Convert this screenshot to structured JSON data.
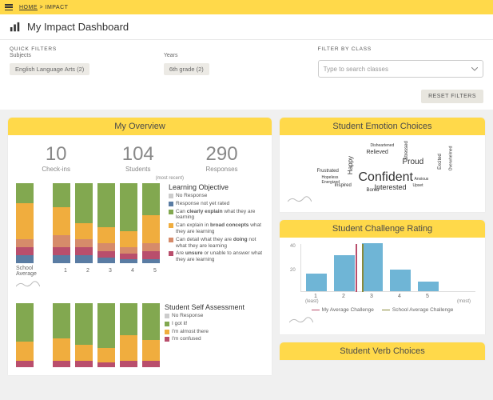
{
  "breadcrumb": {
    "home": "HOME",
    "sep": ">",
    "current": "IMPACT"
  },
  "page_title": "My Impact Dashboard",
  "filters": {
    "quick_label": "QUICK FILTERS",
    "subjects_label": "Subjects",
    "subjects_chip": "English Language Arts (2)",
    "years_label": "Years",
    "years_chip": "6th grade (2)",
    "class_label": "FILTER BY CLASS",
    "class_placeholder": "Type to search classes",
    "reset": "RESET FILTERS"
  },
  "overview": {
    "title": "My Overview",
    "stats": [
      {
        "num": "10",
        "lbl": "Check-ins"
      },
      {
        "num": "104",
        "lbl": "Students"
      },
      {
        "num": "290",
        "lbl": "Responses"
      }
    ],
    "recent": "(most recent)",
    "school_avg": "School Average",
    "bar_labels": [
      "1",
      "2",
      "3",
      "4",
      "5"
    ],
    "lo": {
      "title": "Learning Objective",
      "items": [
        {
          "color": "#ccc",
          "text": "No Response"
        },
        {
          "color": "#5a7ca3",
          "text": "Response not yet rated"
        },
        {
          "color": "#82a850",
          "text": "Can <b>clearly explain</b> what they are learning"
        },
        {
          "color": "#f0ad3e",
          "text": "Can explain in <b>broad concepts</b> what they are learning"
        },
        {
          "color": "#d68b6a",
          "text": "Can detail what they are <b>doing</b> not what they are learning"
        },
        {
          "color": "#b94e6c",
          "text": "Are <b>unsure</b> or unable to answer what they are learning"
        }
      ]
    },
    "ssa": {
      "title": "Student Self Assessment",
      "items": [
        {
          "color": "#ccc",
          "text": "No Response"
        },
        {
          "color": "#82a850",
          "text": "I got it!"
        },
        {
          "color": "#f0ad3e",
          "text": "I'm almost there"
        },
        {
          "color": "#b94e6c",
          "text": "I'm confused"
        }
      ]
    }
  },
  "emotions": {
    "title": "Student Emotion Choices",
    "words": [
      "Confident",
      "Interested",
      "Proud",
      "Happy",
      "Relieved",
      "Bored",
      "Inspired",
      "Frustrated",
      "Hopeless",
      "Anxious",
      "Stressed",
      "Excited",
      "Upset",
      "Energized",
      "Overwhelmed",
      "Disheartened"
    ]
  },
  "challenge": {
    "title": "Student Challenge Rating",
    "mine": "My Average Challenge",
    "school": "School Average Challenge",
    "least": "(least)",
    "most": "(most)"
  },
  "verbs": {
    "title": "Student Verb Choices"
  },
  "chart_data": [
    {
      "type": "bar",
      "name": "learning_objective_stacked",
      "categories": [
        "School Average",
        "1",
        "2",
        "3",
        "4",
        "5"
      ],
      "stack_keys": [
        "clearly_explain",
        "broad_concepts",
        "doing_not_learning",
        "unsure",
        "not_rated"
      ],
      "colors": {
        "clearly_explain": "#82a850",
        "broad_concepts": "#f0ad3e",
        "doing_not_learning": "#d68b6a",
        "unsure": "#b94e6c",
        "not_rated": "#5a7ca3"
      },
      "series_pct": [
        {
          "clearly_explain": 25,
          "broad_concepts": 45,
          "doing_not_learning": 10,
          "unsure": 10,
          "not_rated": 10
        },
        {
          "clearly_explain": 30,
          "broad_concepts": 35,
          "doing_not_learning": 15,
          "unsure": 10,
          "not_rated": 10
        },
        {
          "clearly_explain": 50,
          "broad_concepts": 20,
          "doing_not_learning": 10,
          "unsure": 10,
          "not_rated": 10
        },
        {
          "clearly_explain": 55,
          "broad_concepts": 20,
          "doing_not_learning": 10,
          "unsure": 8,
          "not_rated": 7
        },
        {
          "clearly_explain": 60,
          "broad_concepts": 20,
          "doing_not_learning": 8,
          "unsure": 7,
          "not_rated": 5
        },
        {
          "clearly_explain": 40,
          "broad_concepts": 35,
          "doing_not_learning": 10,
          "unsure": 10,
          "not_rated": 5
        }
      ]
    },
    {
      "type": "bar",
      "name": "self_assessment_stacked",
      "categories": [
        "School Average",
        "1",
        "2",
        "3",
        "4",
        "5"
      ],
      "stack_keys": [
        "got_it",
        "almost",
        "confused"
      ],
      "colors": {
        "got_it": "#82a850",
        "almost": "#f0ad3e",
        "confused": "#b94e6c"
      },
      "series_pct": [
        {
          "got_it": 60,
          "almost": 30,
          "confused": 10
        },
        {
          "got_it": 55,
          "almost": 35,
          "confused": 10
        },
        {
          "got_it": 65,
          "almost": 25,
          "confused": 10
        },
        {
          "got_it": 70,
          "almost": 22,
          "confused": 8
        },
        {
          "got_it": 50,
          "almost": 40,
          "confused": 10
        },
        {
          "got_it": 58,
          "almost": 32,
          "confused": 10
        }
      ]
    },
    {
      "type": "bar",
      "name": "challenge_rating",
      "xlabel": "",
      "ylabel": "",
      "categories": [
        "1",
        "2",
        "3",
        "4",
        "5"
      ],
      "values": [
        15,
        30,
        40,
        18,
        8
      ],
      "ylim": [
        0,
        40
      ],
      "my_average": 2.7,
      "school_average": 2.9
    }
  ]
}
